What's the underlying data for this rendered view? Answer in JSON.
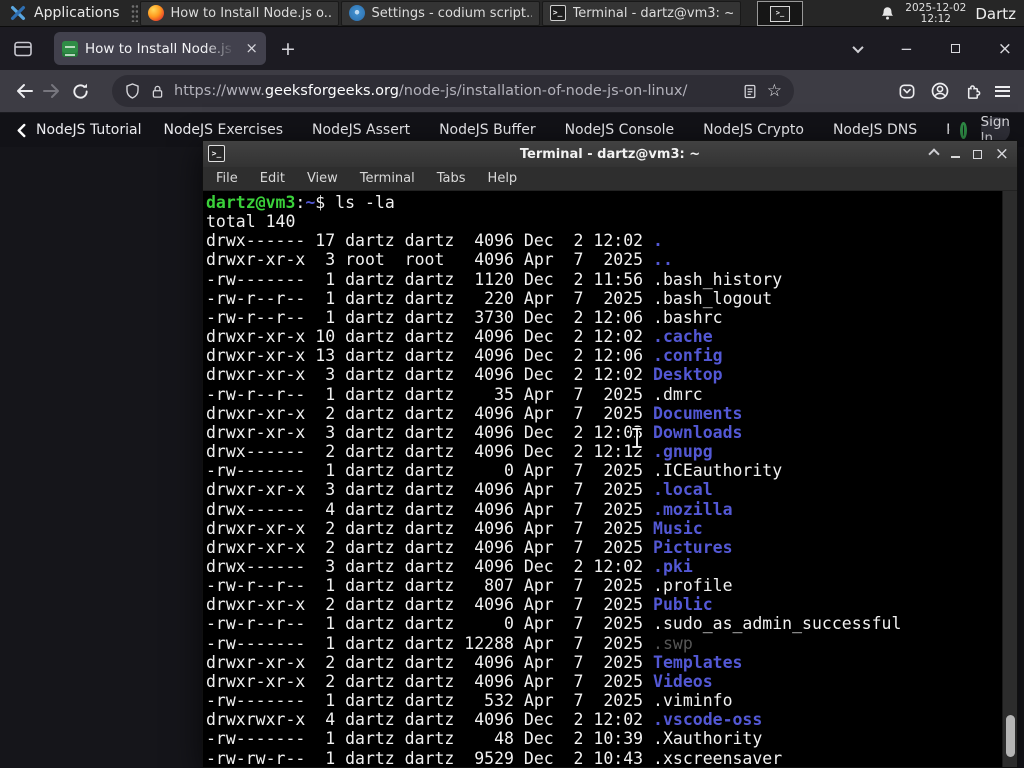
{
  "colors": {
    "panel_bg": "#262626",
    "term_green": "#3ad13a",
    "dir_blue": "#5358d5",
    "term_fg": "#f1f1f1",
    "dim_gray": "#565656",
    "gfg_green": "#2f8d46",
    "accent_tab": "#42414d"
  },
  "panel": {
    "applications_label": "Applications",
    "tasks": [
      {
        "icon": "firefox",
        "label": "How to Install Node.js o..."
      },
      {
        "icon": "codium",
        "label": "Settings - codium script..."
      },
      {
        "icon": "terminal",
        "label": "Terminal - dartz@vm3: ~"
      }
    ],
    "icons": {
      "terminal_glyph": ">_",
      "pager_glyph": ">_"
    },
    "clock_date": "2025-12-02",
    "clock_time": "12:12",
    "user": "Dartz"
  },
  "browser": {
    "tab_title": "How to Install Node.js on",
    "url_scheme": "https://www.",
    "url_domain": "geeksforgeeks.org",
    "url_path": "/node-js/installation-of-node-js-on-linux/",
    "icons": {
      "tab_close": "×",
      "new_tab": "+",
      "minimize": "−",
      "close": "×",
      "star": "☆"
    }
  },
  "site_nav": {
    "back_label": "NodeJS Tutorial",
    "links": [
      "NodeJS Exercises",
      "NodeJS Assert",
      "NodeJS Buffer",
      "NodeJS Console",
      "NodeJS Crypto",
      "NodeJS DNS"
    ],
    "truncated_link": "NodeJS",
    "sign_in_label": "Sign In"
  },
  "terminal": {
    "window_title": "Terminal - dartz@vm3: ~",
    "menu": [
      "File",
      "Edit",
      "View",
      "Terminal",
      "Tabs",
      "Help"
    ],
    "icons": {
      "terminal_glyph": ">_",
      "close": "×"
    },
    "prompt_user_host": "dartz@vm3",
    "prompt_colon": ":",
    "prompt_cwd": "~",
    "prompt_rest": "$ ls -la",
    "total_line": "total 140",
    "rows": [
      {
        "p": "drwx------ 17 dartz dartz  4096 Dec  2 12:02 ",
        "n": ".",
        "t": "d"
      },
      {
        "p": "drwxr-xr-x  3 root  root   4096 Apr  7  2025 ",
        "n": "..",
        "t": "d"
      },
      {
        "p": "-rw-------  1 dartz dartz  1120 Dec  2 11:56 ",
        "n": ".bash_history",
        "t": "f"
      },
      {
        "p": "-rw-r--r--  1 dartz dartz   220 Apr  7  2025 ",
        "n": ".bash_logout",
        "t": "f"
      },
      {
        "p": "-rw-r--r--  1 dartz dartz  3730 Dec  2 12:06 ",
        "n": ".bashrc",
        "t": "f"
      },
      {
        "p": "drwxr-xr-x 10 dartz dartz  4096 Dec  2 12:02 ",
        "n": ".cache",
        "t": "d"
      },
      {
        "p": "drwxr-xr-x 13 dartz dartz  4096 Dec  2 12:06 ",
        "n": ".config",
        "t": "d"
      },
      {
        "p": "drwxr-xr-x  3 dartz dartz  4096 Dec  2 12:02 ",
        "n": "Desktop",
        "t": "d"
      },
      {
        "p": "-rw-r--r--  1 dartz dartz    35 Apr  7  2025 ",
        "n": ".dmrc",
        "t": "f"
      },
      {
        "p": "drwxr-xr-x  2 dartz dartz  4096 Apr  7  2025 ",
        "n": "Documents",
        "t": "d"
      },
      {
        "p": "drwxr-xr-x  3 dartz dartz  4096 Dec  2 12:03 ",
        "n": "Downloads",
        "t": "d"
      },
      {
        "p": "drwx------  2 dartz dartz  4096 Dec  2 12:12 ",
        "n": ".gnupg",
        "t": "d"
      },
      {
        "p": "-rw-------  1 dartz dartz     0 Apr  7  2025 ",
        "n": ".ICEauthority",
        "t": "f"
      },
      {
        "p": "drwxr-xr-x  3 dartz dartz  4096 Apr  7  2025 ",
        "n": ".local",
        "t": "d"
      },
      {
        "p": "drwx------  4 dartz dartz  4096 Apr  7  2025 ",
        "n": ".mozilla",
        "t": "d"
      },
      {
        "p": "drwxr-xr-x  2 dartz dartz  4096 Apr  7  2025 ",
        "n": "Music",
        "t": "d"
      },
      {
        "p": "drwxr-xr-x  2 dartz dartz  4096 Apr  7  2025 ",
        "n": "Pictures",
        "t": "d"
      },
      {
        "p": "drwx------  3 dartz dartz  4096 Dec  2 12:02 ",
        "n": ".pki",
        "t": "d"
      },
      {
        "p": "-rw-r--r--  1 dartz dartz   807 Apr  7  2025 ",
        "n": ".profile",
        "t": "f"
      },
      {
        "p": "drwxr-xr-x  2 dartz dartz  4096 Apr  7  2025 ",
        "n": "Public",
        "t": "d"
      },
      {
        "p": "-rw-r--r--  1 dartz dartz     0 Apr  7  2025 ",
        "n": ".sudo_as_admin_successful",
        "t": "f"
      },
      {
        "p": "-rw-------  1 dartz dartz 12288 Apr  7  2025 ",
        "n": ".swp",
        "t": "x"
      },
      {
        "p": "drwxr-xr-x  2 dartz dartz  4096 Apr  7  2025 ",
        "n": "Templates",
        "t": "d"
      },
      {
        "p": "drwxr-xr-x  2 dartz dartz  4096 Apr  7  2025 ",
        "n": "Videos",
        "t": "d"
      },
      {
        "p": "-rw-------  1 dartz dartz   532 Apr  7  2025 ",
        "n": ".viminfo",
        "t": "f"
      },
      {
        "p": "drwxrwxr-x  4 dartz dartz  4096 Dec  2 12:02 ",
        "n": ".vscode-oss",
        "t": "d"
      },
      {
        "p": "-rw-------  1 dartz dartz    48 Dec  2 10:39 ",
        "n": ".Xauthority",
        "t": "f"
      },
      {
        "p": "-rw-rw-r--  1 dartz dartz  9529 Dec  2 10:43 ",
        "n": ".xscreensaver",
        "t": "f"
      }
    ]
  }
}
